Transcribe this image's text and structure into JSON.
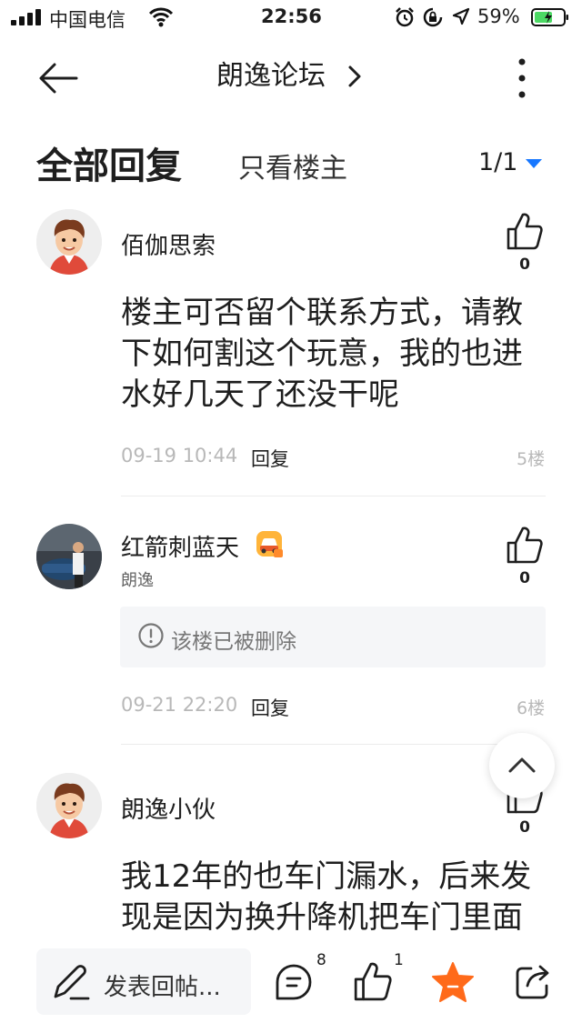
{
  "status_bar": {
    "carrier": "中国电信",
    "time": "22:56",
    "battery_pct": "59%"
  },
  "nav": {
    "title": "朗逸论坛"
  },
  "tabs": {
    "all_replies": "全部回复",
    "owner_only": "只看楼主",
    "page_indicator": "1/1"
  },
  "posts": [
    {
      "username": "佰伽思索",
      "likes": "0",
      "content": [
        "楼主可否留个联系方式，请教",
        "下如何割这个玩意，我的也进",
        "水好几天了还没干呢"
      ],
      "date": "09-19 10:44",
      "reply_label": "回复",
      "floor": "5楼"
    },
    {
      "username": "红箭刺蓝天",
      "subtitle": "朗逸",
      "likes": "0",
      "deleted_text": "该楼已被删除",
      "date": "09-21 22:20",
      "reply_label": "回复",
      "floor": "6楼"
    },
    {
      "username": "朗逸小伙",
      "likes": "0",
      "content": [
        "我12年的也车门漏水，后来发",
        "现是因为换升降机把车门里面"
      ]
    }
  ],
  "bottom_bar": {
    "compose_label": "发表回帖...",
    "comment_count": "8",
    "like_count": "1"
  },
  "colors": {
    "accent_blue": "#1677ff",
    "favorite_orange": "#ff6a1a",
    "battery_green": "#4cd964"
  },
  "icons": [
    "signal-icon",
    "wifi-icon",
    "alarm-icon",
    "rotation-lock-icon",
    "location-icon",
    "battery-icon",
    "back-arrow-icon",
    "chevron-right-icon",
    "more-vertical-icon",
    "thumbs-up-icon",
    "info-icon",
    "chevron-up-icon",
    "edit-icon",
    "comment-icon",
    "star-icon",
    "share-icon"
  ]
}
